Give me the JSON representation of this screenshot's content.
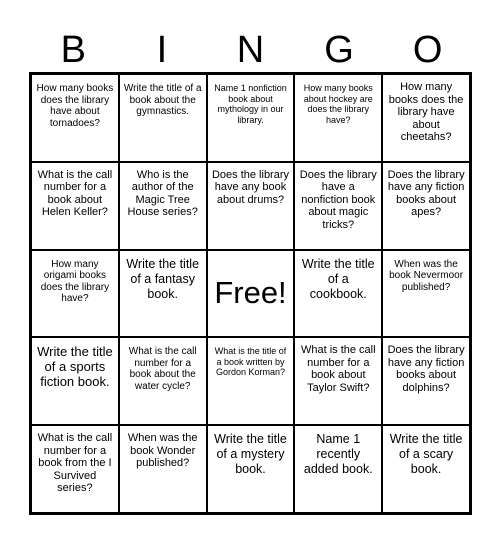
{
  "header": {
    "letters": [
      "B",
      "I",
      "N",
      "G",
      "O"
    ]
  },
  "cells": [
    [
      "How many books does the library have about tornadoes?",
      "Write the title of a book about the gymnastics.",
      "Name 1 nonfiction book about mythology in our library.",
      "How many books about hockey are does the library have?",
      "How many books does the library have about cheetahs?"
    ],
    [
      "What is the call number for a book about Helen Keller?",
      "Who is the author of the Magic Tree House series?",
      "Does the library have any book about drums?",
      "Does the library have a nonfiction book about magic tricks?",
      "Does the library have any fiction books about apes?"
    ],
    [
      "How many origami books does the library have?",
      "Write the title of a fantasy book.",
      "Free!",
      "Write the title of a cookbook.",
      "When was the book Nevermoor published?"
    ],
    [
      "Write the title of a sports fiction book.",
      "What is the call number for a book about the water cycle?",
      "What is the title of a book written by Gordon Korman?",
      "What is the call number for a book about Taylor Swift?",
      "Does the library have any fiction books about dolphins?"
    ],
    [
      "What is the call number for a book from the I Survived series?",
      "When was the book Wonder published?",
      "Write the title of a mystery book.",
      "Name 1 recently added book.",
      "Write the title of a scary book."
    ]
  ]
}
